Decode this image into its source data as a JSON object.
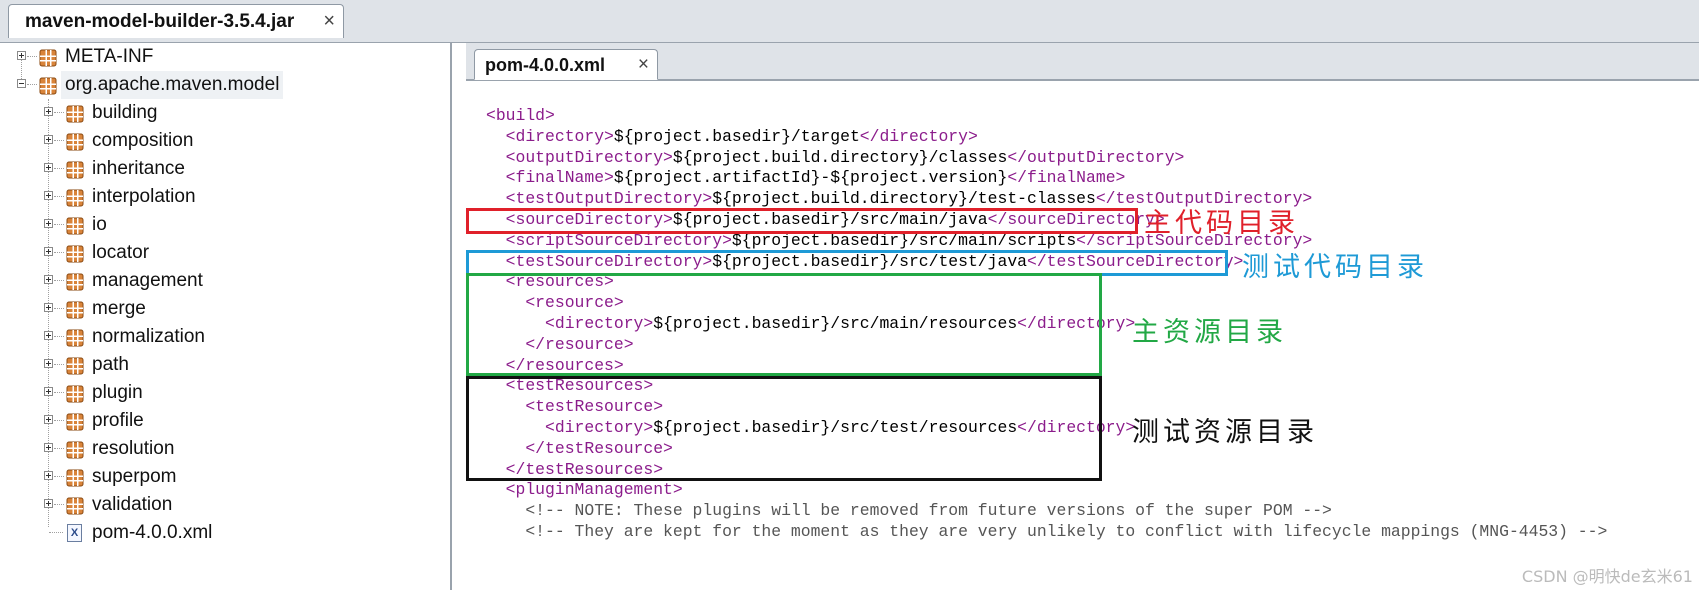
{
  "outer_tab": {
    "title": "maven-model-builder-3.5.4.jar",
    "close": "×"
  },
  "tree": {
    "roots": [
      {
        "label": "META-INF",
        "icon": "package-icon",
        "expanded": false
      },
      {
        "label": "org.apache.maven.model",
        "icon": "package-icon",
        "expanded": true
      }
    ],
    "children": [
      "building",
      "composition",
      "inheritance",
      "interpolation",
      "io",
      "locator",
      "management",
      "merge",
      "normalization",
      "path",
      "plugin",
      "profile",
      "resolution",
      "superpom",
      "validation"
    ],
    "file": {
      "label": "pom-4.0.0.xml",
      "icon": "xml-file-icon",
      "icon_glyph": "X"
    }
  },
  "editor_tab": {
    "title": "pom-4.0.0.xml",
    "close": "×"
  },
  "code": [
    [
      {
        "t": "tag",
        "v": "<build>"
      }
    ],
    [
      {
        "t": "tag",
        "v": "  <directory>"
      },
      {
        "t": "txt",
        "v": "${project.basedir}/target"
      },
      {
        "t": "tag",
        "v": "</directory>"
      }
    ],
    [
      {
        "t": "tag",
        "v": "  <outputDirectory>"
      },
      {
        "t": "txt",
        "v": "${project.build.directory}/classes"
      },
      {
        "t": "tag",
        "v": "</outputDirectory>"
      }
    ],
    [
      {
        "t": "tag",
        "v": "  <finalName>"
      },
      {
        "t": "txt",
        "v": "${project.artifactId}-${project.version}"
      },
      {
        "t": "tag",
        "v": "</finalName>"
      }
    ],
    [
      {
        "t": "tag",
        "v": "  <testOutputDirectory>"
      },
      {
        "t": "txt",
        "v": "${project.build.directory}/test-classes"
      },
      {
        "t": "tag",
        "v": "</testOutputDirectory>"
      }
    ],
    [
      {
        "t": "tag",
        "v": "  <sourceDirectory>"
      },
      {
        "t": "txt",
        "v": "${project.basedir}/src/main/java"
      },
      {
        "t": "tag",
        "v": "</sourceDirectory>"
      }
    ],
    [
      {
        "t": "tag",
        "v": "  <scriptSourceDirectory>"
      },
      {
        "t": "txt",
        "v": "${project.basedir}/src/main/scripts"
      },
      {
        "t": "tag",
        "v": "</scriptSourceDirectory>"
      }
    ],
    [
      {
        "t": "tag",
        "v": "  <testSourceDirectory>"
      },
      {
        "t": "txt",
        "v": "${project.basedir}/src/test/java"
      },
      {
        "t": "tag",
        "v": "</testSourceDirectory>"
      }
    ],
    [
      {
        "t": "tag",
        "v": "  <resources>"
      }
    ],
    [
      {
        "t": "tag",
        "v": "    <resource>"
      }
    ],
    [
      {
        "t": "tag",
        "v": "      <directory>"
      },
      {
        "t": "txt",
        "v": "${project.basedir}/src/main/resources"
      },
      {
        "t": "tag",
        "v": "</directory>"
      }
    ],
    [
      {
        "t": "tag",
        "v": "    </resource>"
      }
    ],
    [
      {
        "t": "tag",
        "v": "  </resources>"
      }
    ],
    [
      {
        "t": "tag",
        "v": "  <testResources>"
      }
    ],
    [
      {
        "t": "tag",
        "v": "    <testResource>"
      }
    ],
    [
      {
        "t": "tag",
        "v": "      <directory>"
      },
      {
        "t": "txt",
        "v": "${project.basedir}/src/test/resources"
      },
      {
        "t": "tag",
        "v": "</directory>"
      }
    ],
    [
      {
        "t": "tag",
        "v": "    </testResource>"
      }
    ],
    [
      {
        "t": "tag",
        "v": "  </testResources>"
      }
    ],
    [
      {
        "t": "tag",
        "v": "  <pluginManagement>"
      }
    ],
    [
      {
        "t": "cmt",
        "v": "    <!-- NOTE: These plugins will be removed from future versions of the super POM -->"
      }
    ],
    [
      {
        "t": "cmt",
        "v": "    <!-- They are kept for the moment as they are very unlikely to conflict with lifecycle mappings (MNG-4453) -->"
      }
    ]
  ],
  "annotations": {
    "main_source": {
      "text": "主代码目录",
      "color": "#e0202a"
    },
    "test_source": {
      "text": "测试代码目录",
      "color": "#1e9ad6"
    },
    "main_resources": {
      "text": "主资源目录",
      "color": "#22a845"
    },
    "test_resources": {
      "text": "测试资源目录",
      "color": "#111111"
    }
  },
  "watermark": "CSDN @明快de玄米61"
}
